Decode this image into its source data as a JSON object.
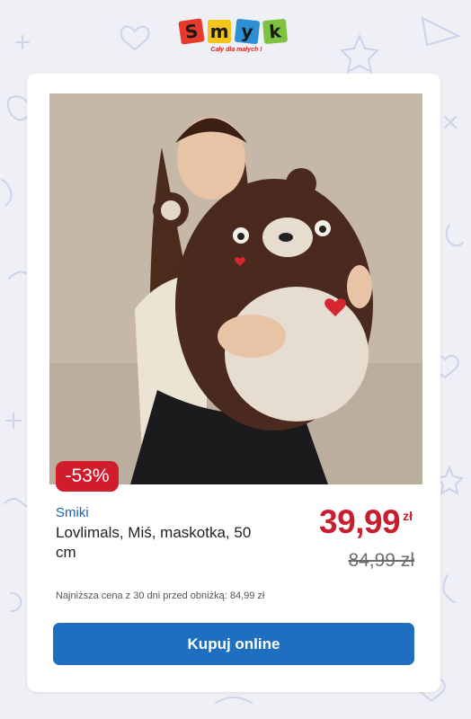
{
  "logo": {
    "letters": [
      "S",
      "m",
      "y",
      "k"
    ],
    "letter_colors": [
      "#e8392a",
      "#f3c419",
      "#2e8fd4",
      "#7ec242"
    ],
    "tagline": "Cały dla małych !"
  },
  "product": {
    "image_icon": "plush-bear-photo",
    "discount_badge": "-53%",
    "brand": "Smiki",
    "title": "Lovlimals, Miś, maskotka, 50 cm",
    "price": "39,99",
    "currency": "zł",
    "old_price": "84,99 zł",
    "lowest_price_note": "Najniższa cena z 30 dni przed obniżką: 84,99 zł"
  },
  "cta": {
    "label": "Kupuj online"
  },
  "colors": {
    "accent_blue": "#1e6fc0",
    "price_red": "#c81e2d",
    "badge_red": "#d11c2c",
    "page_bg": "#eef0f6"
  }
}
